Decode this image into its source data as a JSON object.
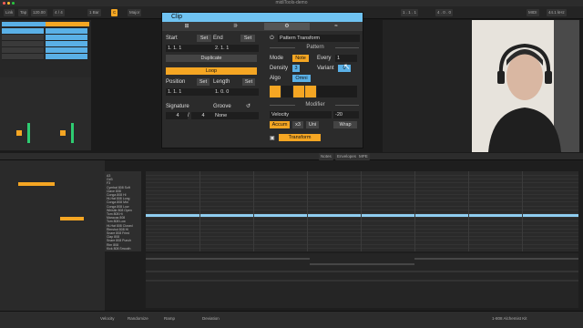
{
  "window": {
    "title": "midiTools-demo"
  },
  "toolbar": {
    "link": "Link",
    "tap": "Tap",
    "tempo": "120.00",
    "signature": "4 / 4",
    "bar": "1 Bar",
    "key": "C",
    "scale": "Major",
    "position": "1 . 1 . 1",
    "time": "4 . 0 . 0",
    "midi_in": "MIDI",
    "cpu": "44.1 kHz"
  },
  "clip_window": {
    "title": "Clip",
    "sections": {
      "start_label": "Start",
      "start_set": "Set",
      "start_value": "1. 1. 1",
      "end_label": "End",
      "end_set": "Set",
      "end_value": "2. 1. 1",
      "duplicate": "Duplicate",
      "loop": "Loop",
      "position_label": "Position",
      "position_set": "Set",
      "position_value": "1. 1. 1",
      "length_label": "Length",
      "length_set": "Set",
      "length_value": "1. 0. 0",
      "signature_label": "Signature",
      "sig_num": "4",
      "sig_den": "4",
      "groove_label": "Groove",
      "groove_value": "None"
    },
    "transform": {
      "device": "Pattern Transform",
      "pattern_header": "Pattern",
      "mode_label": "Mode",
      "mode_value": "Note",
      "every_label": "Every",
      "every_value": "1",
      "density_label": "Density",
      "density_value": "3",
      "variant_label": "Variant",
      "variant_value": "0",
      "algo_label": "Algo",
      "algo_value": "Omni",
      "modifier_header": "Modifier",
      "modifier_select": "Velocity",
      "modifier_value": "-20",
      "accum": "Accum",
      "x3": "x3",
      "uni": "Uni",
      "wrap": "Wrap",
      "transform_button": "Transform"
    }
  },
  "note_editor": {
    "tabs": [
      "Notes",
      "Envelopes",
      "MPE"
    ],
    "note_names": [
      "A3",
      "G#3",
      "F3",
      "Cymbal 808 Soft",
      "Clave 808",
      "Conga 808 Hi",
      "Hi-Hat 808 Long",
      "Conga 808 Mid",
      "Conga 808 Low",
      "Whistle 808 Open",
      "Tom 808 Hi",
      "Maracas 808",
      "Tom 808 Low",
      "Hi-Hat 808 Closed",
      "Rimshot 808 Hi",
      "Snare 808 Fried",
      "Clap 808",
      "Snare 808 Punch",
      "Rim 808",
      "Kick 808 Smooth"
    ]
  },
  "status": {
    "left": "Velocity",
    "mid": "Randomize",
    "ramp": "Ramp",
    "deviation": "Deviation",
    "track": "1-808 Alchemist Kit"
  }
}
